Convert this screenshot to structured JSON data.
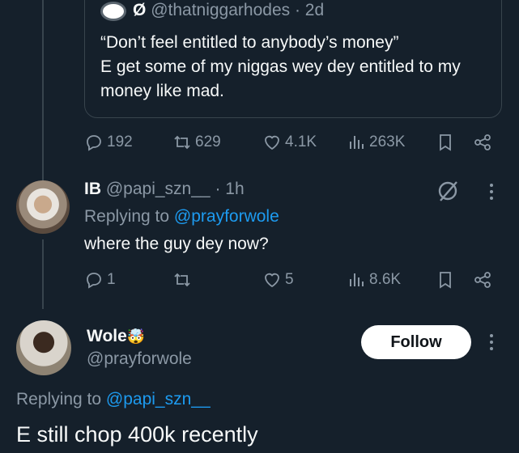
{
  "quoted_tweet": {
    "author_name": "Ø",
    "handle": "@thatniggarhodes",
    "time": "· 2d",
    "lines": [
      "“Don’t feel entitled to anybody’s money”",
      "E get some of my niggas wey dey entitled to my",
      "money like mad."
    ]
  },
  "tweet1_actions": {
    "replies": "192",
    "retweets": "629",
    "likes": "4.1K",
    "views": "263K"
  },
  "reply": {
    "name": "IB",
    "handle": "@papi_szn__",
    "time": "· 1h",
    "replying_prefix": "Replying to",
    "replying_to": "@prayforwole",
    "text": "where the guy dey now?",
    "replies": "1",
    "retweets": "",
    "likes": "5",
    "views": "8.6K"
  },
  "main_tweet": {
    "name": "Wole",
    "name_emoji": "🤯",
    "handle": "@prayforwole",
    "follow_label": "Follow",
    "replying_prefix": "Replying to",
    "replying_to": "@papi_szn__",
    "text": "E still chop 400k recently"
  },
  "colors": {
    "background": "#15202b",
    "accent": "#1d9bf0",
    "muted": "#8b98a5",
    "border": "#38444d"
  }
}
